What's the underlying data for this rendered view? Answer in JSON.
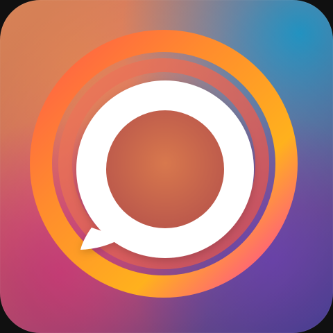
{
  "app_icon": {
    "name": "chat-camera-app-icon",
    "icon_semantics": [
      "rounded-square-icon",
      "ring-icon",
      "speech-bubble-icon"
    ],
    "colors": {
      "top_left": "#f0945c",
      "top_right": "#13a6df",
      "bottom_left": "#e74488",
      "bottom_right": "#794ac4",
      "outer_ring_start": "#ff3f8f",
      "outer_ring_mid": "#ff7a3c",
      "outer_ring_end": "#ffb020",
      "inner_fill": "#c8694c",
      "bubble": "#ffffff"
    }
  }
}
